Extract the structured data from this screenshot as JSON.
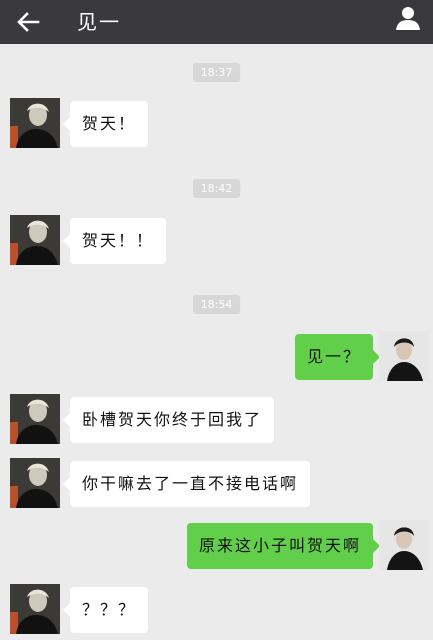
{
  "header": {
    "title": "见一",
    "back_icon": "arrow-left-icon",
    "profile_icon": "person-icon"
  },
  "messages": [
    {
      "type": "timestamp",
      "text": "18:37"
    },
    {
      "type": "incoming",
      "text": "贺天！"
    },
    {
      "type": "timestamp",
      "text": "18:42"
    },
    {
      "type": "incoming",
      "text": "贺天！！"
    },
    {
      "type": "timestamp",
      "text": "18:54"
    },
    {
      "type": "outgoing",
      "text": "见一？"
    },
    {
      "type": "incoming",
      "text": "卧槽贺天你终于回我了"
    },
    {
      "type": "incoming",
      "text": "你干嘛去了一直不接电话啊"
    },
    {
      "type": "outgoing",
      "text": "原来这小子叫贺天啊"
    },
    {
      "type": "incoming",
      "text": "？？？"
    }
  ],
  "colors": {
    "topbar": "#3a3a3c",
    "background": "#ebebeb",
    "outgoing_bubble": "#62cf4b",
    "incoming_bubble": "#ffffff",
    "timestamp_bg": "#d7d7d7"
  }
}
